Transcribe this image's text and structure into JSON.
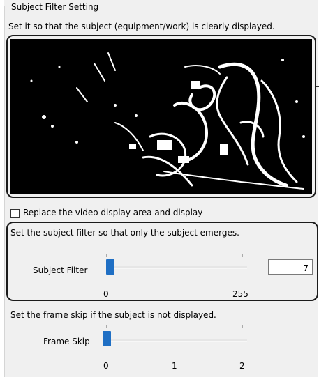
{
  "group_title": "Subject Filter Setting",
  "preview": {
    "instruction": "Set it so that the subject (equipment/work) is clearly displayed."
  },
  "replace_checkbox": {
    "label": "Replace the video display area and display",
    "checked": false
  },
  "subject_filter": {
    "instruction": "Set the subject filter so that only the subject emerges.",
    "label": "Subject Filter",
    "value": "7",
    "slider_fraction": 0.027,
    "min_label": "0",
    "max_label": "255"
  },
  "frame_skip": {
    "instruction": "Set the frame skip if the subject is not displayed.",
    "label": "Frame Skip",
    "value": 0,
    "tick_labels": [
      "0",
      "1",
      "2"
    ]
  },
  "colors": {
    "accent": "#1f6fc4",
    "highlight": "#1b1b1b",
    "panel_bg": "#f0f0f0"
  }
}
